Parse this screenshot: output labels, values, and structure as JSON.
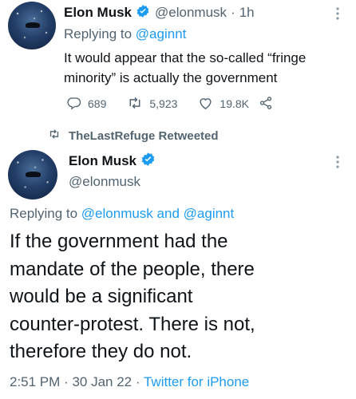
{
  "tweet1": {
    "display_name": "Elon Musk",
    "handle": "@elonmusk",
    "separator": "·",
    "time": "1h",
    "replying_prefix": "Replying to",
    "replying_to": "@aginnt",
    "text": "It would appear that the so-called “fringe\nminority” is actually the government",
    "replies": "689",
    "retweets": "5,923",
    "likes": "19.8K"
  },
  "retweet_banner": {
    "label": "TheLastRefuge Retweeted"
  },
  "tweet2": {
    "display_name": "Elon Musk",
    "handle": "@elonmusk",
    "replying_prefix": "Replying to",
    "replying_to_1": "@elonmusk",
    "and": "and",
    "replying_to_2": "@aginnt",
    "text": "If the government had the\nmandate of the people, there\nwould be a significant\ncounter-protest. There is not,\ntherefore they do not.",
    "time": "2:51 PM",
    "separator_1": "·",
    "date": "30 Jan 22",
    "separator_2": "·",
    "source": "Twitter for iPhone"
  },
  "icons": [
    "verified-badge-icon",
    "more-icon",
    "reply-icon",
    "retweet-icon",
    "like-icon",
    "share-icon"
  ],
  "colors": {
    "link": "#1d9bf0",
    "secondary_text": "#536471",
    "verified": "#1d9bf0",
    "text": "#0f1419"
  }
}
